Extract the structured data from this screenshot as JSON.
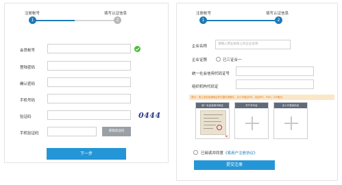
{
  "left": {
    "steps": [
      {
        "label": "注册帐号",
        "number": "1"
      },
      {
        "label": "填写认证信息",
        "number": "2"
      }
    ],
    "fields": {
      "account_label": "会员帐号",
      "password_label": "登陆密码",
      "confirm_label": "确认密码",
      "phone_label": "手机号码",
      "captcha_label": "验证码",
      "sms_label": "手机验证码"
    },
    "captcha_text": "0444",
    "sms_button": "获取验证码",
    "next_button": "下一步"
  },
  "right": {
    "steps": [
      {
        "label": "注册帐号",
        "number": "1"
      },
      {
        "label": "填写认证信息",
        "number": "2"
      }
    ],
    "company_label": "企业名称",
    "company_placeholder": "请输入营业执照上的企业名称",
    "cert_label": "企业证照",
    "cert_option": "已三证合一",
    "credit_label": "统一社会信用代码证号",
    "org_label": "组织机构代码证",
    "tip": "提示：请上传彩色清晰证件扫描件或照片，大小不超过5M，支持JPG、PNG、GIF格式。",
    "uploads": [
      {
        "title": "统一社会信用代码证"
      },
      {
        "title": "开户许可证"
      },
      {
        "title": "法人代表身份证"
      }
    ],
    "agree_prefix": "已阅读并同意",
    "agree_link": "《易用户注册协议》",
    "submit_button": "提交注册"
  },
  "colors": {
    "accent": "#2496d7",
    "step_active": "#1d7bb8",
    "success": "#44c035",
    "captcha": "#2a3a88"
  }
}
